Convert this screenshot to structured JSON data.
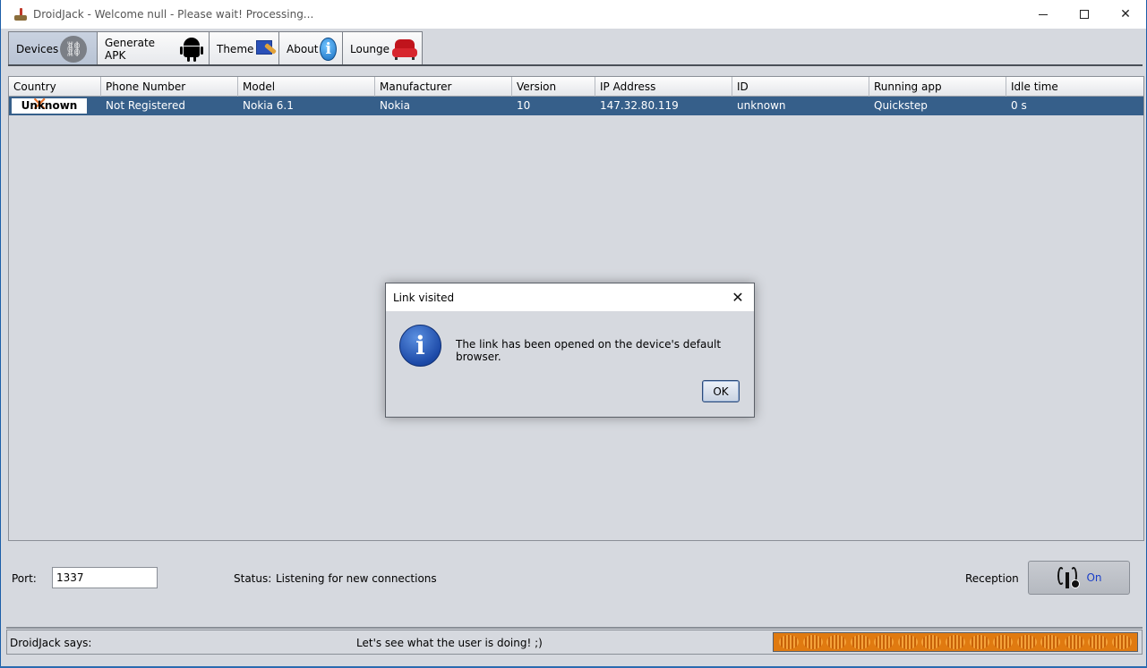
{
  "window": {
    "title": "DroidJack - Welcome null - Please wait! Processing..."
  },
  "tabs": [
    {
      "label": "Devices",
      "icon": "link-icon",
      "active": true
    },
    {
      "label": "Generate APK",
      "icon": "android-icon",
      "active": false
    },
    {
      "label": "Theme",
      "icon": "theme-icon",
      "active": false
    },
    {
      "label": "About",
      "icon": "info-icon",
      "active": false
    },
    {
      "label": "Lounge",
      "icon": "sofa-icon",
      "active": false
    }
  ],
  "table": {
    "columns": [
      "Country",
      "Phone Number",
      "Model",
      "Manufacturer",
      "Version",
      "IP Address",
      "ID",
      "Running app",
      "Idle time"
    ],
    "rows": [
      {
        "country": "Unknown",
        "phone": "Not Registered",
        "model": "Nokia 6.1",
        "manufacturer": "Nokia",
        "version": "10",
        "ip": "147.32.80.119",
        "id": "unknown",
        "running_app": "Quickstep",
        "idle": "0 s"
      }
    ]
  },
  "controls": {
    "port_label": "Port:",
    "port_value": "1337",
    "status_label": "Status:",
    "status_value": "Listening for new connections",
    "reception_label": "Reception",
    "reception_state": "On"
  },
  "statusbar": {
    "says_label": "DroidJack says:",
    "message": "Let's see what the user is doing! ;)"
  },
  "dialog": {
    "title": "Link visited",
    "message": "The link has been opened on the device's default browser.",
    "ok_label": "OK"
  },
  "colors": {
    "selected_row": "#365f8a",
    "accent_orange": "#e07a10",
    "reception_on": "#1a3ec8"
  }
}
